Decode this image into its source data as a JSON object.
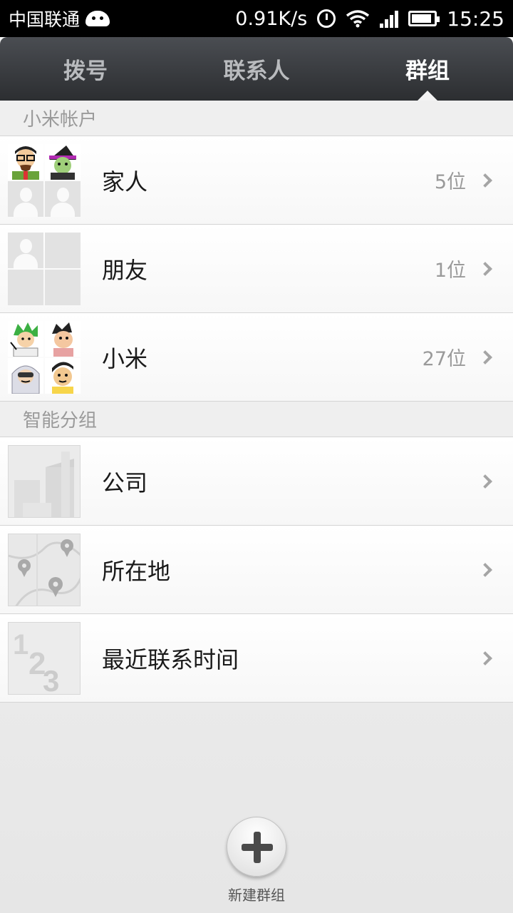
{
  "status_bar": {
    "carrier": "中国联通",
    "speed": "0.91K/s",
    "time": "15:25",
    "battery_level": 0.9
  },
  "tabs": [
    {
      "label": "拨号",
      "active": false
    },
    {
      "label": "联系人",
      "active": false
    },
    {
      "label": "群组",
      "active": true
    }
  ],
  "sections": [
    {
      "header": "小米帐户",
      "items": [
        {
          "label": "家人",
          "count": "5位"
        },
        {
          "label": "朋友",
          "count": "1位"
        },
        {
          "label": "小米",
          "count": "27位"
        }
      ]
    },
    {
      "header": "智能分组",
      "items": [
        {
          "label": "公司"
        },
        {
          "label": "所在地"
        },
        {
          "label": "最近联系时间"
        }
      ]
    }
  ],
  "new_group": {
    "label": "新建群组"
  },
  "colors": {
    "tab_bar": "#3a3c40",
    "tab_active_text": "#ffffff",
    "tab_inactive_text": "#b9bbbe",
    "section_text": "#9a9a9a"
  }
}
